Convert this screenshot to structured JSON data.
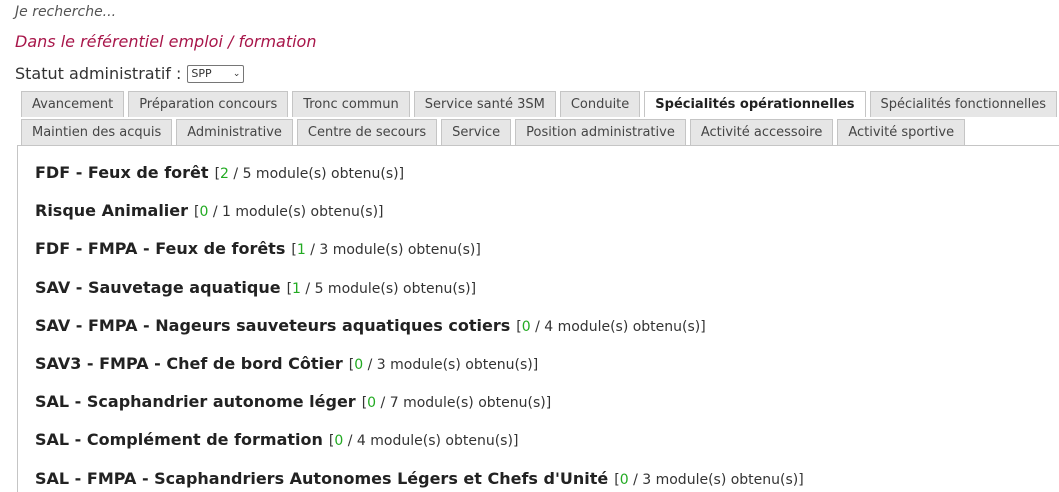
{
  "header": {
    "search_label": "Je recherche...",
    "subtitle": "Dans le référentiel emploi / formation",
    "statut_label": "Statut administratif :",
    "statut_value": "SPP"
  },
  "tabs_row1": [
    {
      "label": "Avancement",
      "active": false
    },
    {
      "label": "Préparation concours",
      "active": false
    },
    {
      "label": "Tronc commun",
      "active": false
    },
    {
      "label": "Service santé 3SM",
      "active": false
    },
    {
      "label": "Conduite",
      "active": false
    },
    {
      "label": "Spécialités opérationnelles",
      "active": true
    },
    {
      "label": "Spécialités fonctionnelles",
      "active": false
    }
  ],
  "tabs_row2": [
    {
      "label": "Maintien des acquis",
      "active": false
    },
    {
      "label": "Administrative",
      "active": false
    },
    {
      "label": "Centre de secours",
      "active": false
    },
    {
      "label": "Service",
      "active": false
    },
    {
      "label": "Position administrative",
      "active": false
    },
    {
      "label": "Activité accessoire",
      "active": false
    },
    {
      "label": "Activité sportive",
      "active": false
    }
  ],
  "specialites": [
    {
      "name": "FDF - Feux de forêt",
      "obtained": "2",
      "rest": " / 5 module(s) obtenu(s)]"
    },
    {
      "name": "Risque Animalier",
      "obtained": "0",
      "rest": " / 1 module(s) obtenu(s)]"
    },
    {
      "name": "FDF - FMPA - Feux de forêts",
      "obtained": "1",
      "rest": " / 3 module(s) obtenu(s)]"
    },
    {
      "name": "SAV - Sauvetage aquatique",
      "obtained": "1",
      "rest": " / 5 module(s) obtenu(s)]"
    },
    {
      "name": "SAV - FMPA - Nageurs sauveteurs aquatiques cotiers",
      "obtained": "0",
      "rest": " / 4 module(s) obtenu(s)]"
    },
    {
      "name": "SAV3 - FMPA - Chef de bord Côtier",
      "obtained": "0",
      "rest": " / 3 module(s) obtenu(s)]"
    },
    {
      "name": "SAL - Scaphandrier autonome léger",
      "obtained": "0",
      "rest": " / 7 module(s) obtenu(s)]"
    },
    {
      "name": "SAL - Complément de formation",
      "obtained": "0",
      "rest": " / 4 module(s) obtenu(s)]"
    },
    {
      "name": "SAL - FMPA - Scaphandriers Autonomes Légers et Chefs d'Unité",
      "obtained": "0",
      "rest": " / 3 module(s) obtenu(s)]"
    }
  ],
  "colors": {
    "subtitle": "#a8164a",
    "obtained_count": "#22aa22"
  }
}
